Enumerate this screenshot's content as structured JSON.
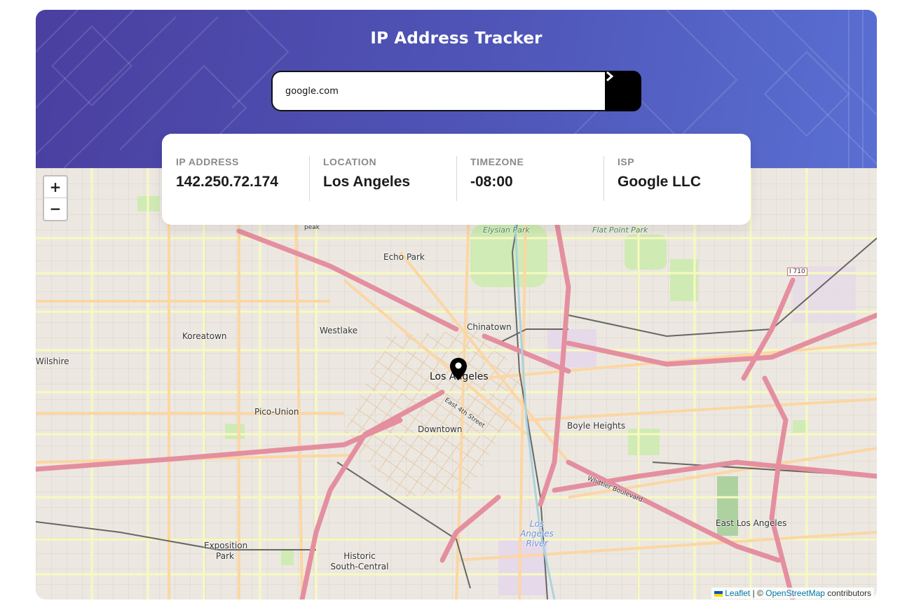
{
  "header": {
    "title": "IP Address Tracker",
    "search_value": "google.com"
  },
  "info": {
    "ip": {
      "label": "IP ADDRESS",
      "value": "142.250.72.174"
    },
    "location": {
      "label": "LOCATION",
      "value": "Los Angeles"
    },
    "timezone": {
      "label": "TIMEZONE",
      "value": "-08:00"
    },
    "isp": {
      "label": "ISP",
      "value": "Google LLC"
    }
  },
  "map": {
    "zoom_in": "+",
    "zoom_out": "−",
    "labels": {
      "echo_park": "Echo Park",
      "elysian_park": "Elysian Park",
      "flat_point_park": "Flat Point Park",
      "chinatown": "Chinatown",
      "westlake": "Westlake",
      "koreatown": "Koreatown",
      "wilshire": "Wilshire",
      "los_angeles": "Los Angeles",
      "downtown": "Downtown",
      "pico_union": "Pico-Union",
      "boyle_heights": "Boyle Heights",
      "east_los_angeles": "East Los Angeles",
      "exposition_park": "Exposition Park",
      "historic_south_central": "Historic South-Central",
      "la_river": "Los Angeles River",
      "east_4th_street": "East 4th Street",
      "whittier_boulevard": "Whittier Boulevard",
      "i710": "I 710",
      "peak": "peak"
    },
    "attribution": {
      "leaflet": "Leaflet",
      "sep": "| ©",
      "osm": "OpenStreetMap",
      "contributors": "contributors"
    }
  },
  "colors": {
    "header_start": "#4a3fa0",
    "header_end": "#5a6fd2",
    "highway": "#e48f9f",
    "primary_road": "#fcd6a4",
    "secondary_road": "#f7fabf",
    "map_bg": "#f2efe9"
  }
}
